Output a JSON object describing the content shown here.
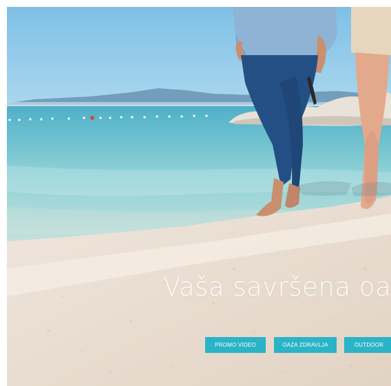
{
  "hero": {
    "headline": "Vaša savršena oaza",
    "buttons": [
      {
        "label": "PROMO VIDEO"
      },
      {
        "label": "OAZA ZDRAVLJA"
      },
      {
        "label": "OUTDOOR"
      }
    ]
  },
  "colors": {
    "button_bg": "#2bb3c8",
    "button_text": "#ffffff",
    "headline_text": "#ffffff"
  }
}
